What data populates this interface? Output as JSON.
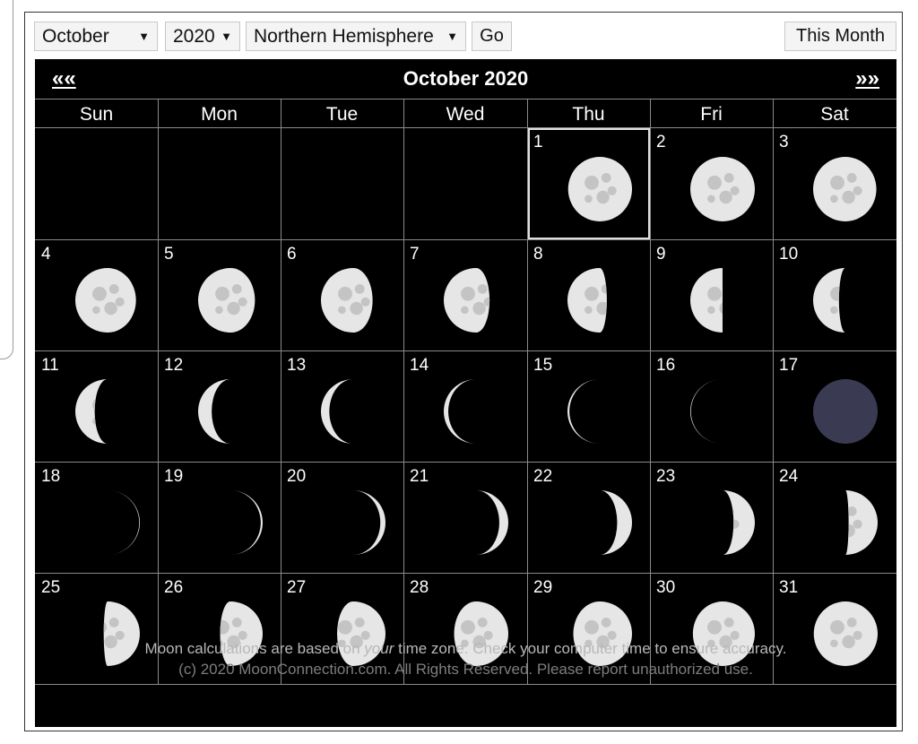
{
  "controls": {
    "month_value": "October",
    "year_value": "2020",
    "hemisphere_value": "Northern Hemisphere",
    "dropdown_arrow": "▼",
    "go_label": "Go",
    "this_month_label": "This Month"
  },
  "calendar": {
    "title": "October 2020",
    "prev_label": "««",
    "next_label": "»»",
    "weekdays": [
      "Sun",
      "Mon",
      "Tue",
      "Wed",
      "Thu",
      "Fri",
      "Sat"
    ],
    "first_weekday_index": 4,
    "today": 1,
    "days": [
      {
        "day": "1",
        "illum": 0.99,
        "side": "R"
      },
      {
        "day": "2",
        "illum": 1.0,
        "side": "R"
      },
      {
        "day": "3",
        "illum": 0.98,
        "side": "L"
      },
      {
        "day": "4",
        "illum": 0.94,
        "side": "L"
      },
      {
        "day": "5",
        "illum": 0.88,
        "side": "L"
      },
      {
        "day": "6",
        "illum": 0.8,
        "side": "L"
      },
      {
        "day": "7",
        "illum": 0.71,
        "side": "L"
      },
      {
        "day": "8",
        "illum": 0.61,
        "side": "L"
      },
      {
        "day": "9",
        "illum": 0.5,
        "side": "L"
      },
      {
        "day": "10",
        "illum": 0.4,
        "side": "L"
      },
      {
        "day": "11",
        "illum": 0.3,
        "side": "L"
      },
      {
        "day": "12",
        "illum": 0.21,
        "side": "L"
      },
      {
        "day": "13",
        "illum": 0.13,
        "side": "L"
      },
      {
        "day": "14",
        "illum": 0.07,
        "side": "L"
      },
      {
        "day": "15",
        "illum": 0.03,
        "side": "L"
      },
      {
        "day": "16",
        "illum": 0.01,
        "side": "L"
      },
      {
        "day": "17",
        "illum": 0.0,
        "side": "N"
      },
      {
        "day": "18",
        "illum": 0.01,
        "side": "R"
      },
      {
        "day": "19",
        "illum": 0.03,
        "side": "R"
      },
      {
        "day": "20",
        "illum": 0.08,
        "side": "R"
      },
      {
        "day": "21",
        "illum": 0.14,
        "side": "R"
      },
      {
        "day": "22",
        "illum": 0.23,
        "side": "R"
      },
      {
        "day": "23",
        "illum": 0.33,
        "side": "R"
      },
      {
        "day": "24",
        "illum": 0.45,
        "side": "R"
      },
      {
        "day": "25",
        "illum": 0.56,
        "side": "R"
      },
      {
        "day": "26",
        "illum": 0.66,
        "side": "R"
      },
      {
        "day": "27",
        "illum": 0.75,
        "side": "R"
      },
      {
        "day": "28",
        "illum": 0.84,
        "side": "R"
      },
      {
        "day": "29",
        "illum": 0.91,
        "side": "R"
      },
      {
        "day": "30",
        "illum": 0.96,
        "side": "R"
      },
      {
        "day": "31",
        "illum": 0.99,
        "side": "R"
      }
    ]
  },
  "footer": {
    "line1_a": "Moon calculations are based on ",
    "line1_em": "your",
    "line1_b": " time zone. Check your computer time to ensure accuracy.",
    "line2": "(c) 2020 MoonConnection.com. All Rights Reserved. Please report unauthorized use."
  },
  "colors": {
    "moon_light": "#e6e6e6",
    "moon_dark": "#000000",
    "new_moon": "#3a3a52",
    "grid": "#8a8a8a"
  }
}
